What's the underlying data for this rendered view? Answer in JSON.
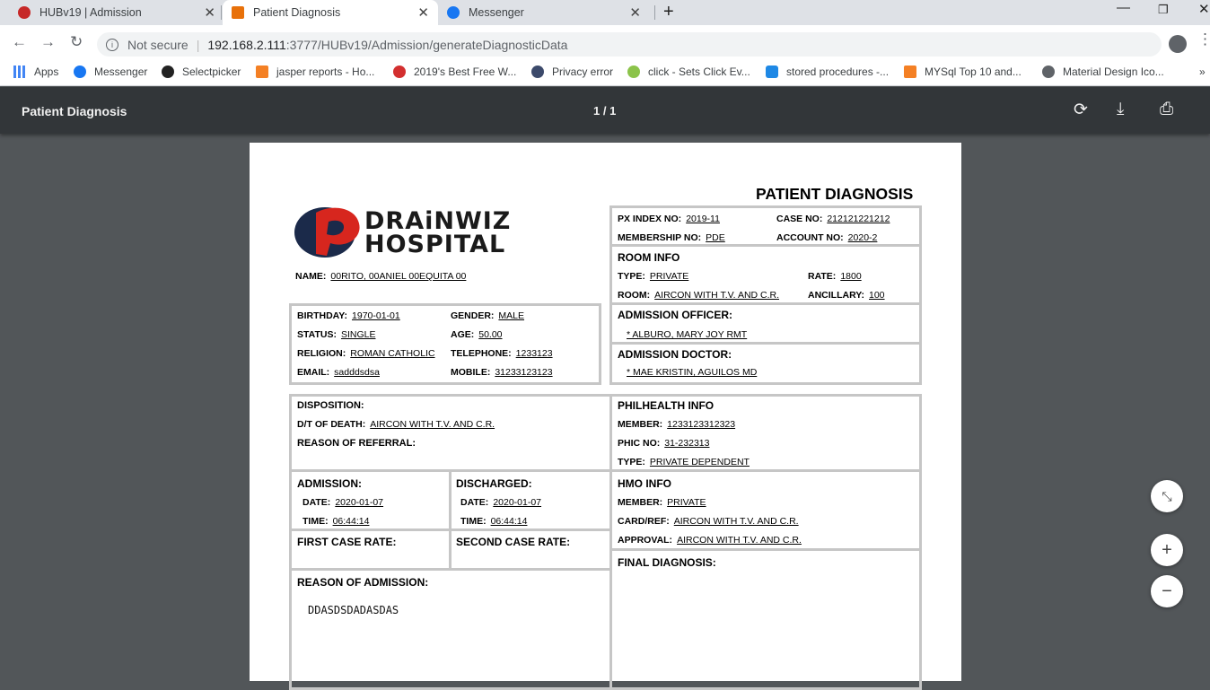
{
  "browser": {
    "tabs": [
      {
        "title": "HUBv19 | Admission",
        "active": false
      },
      {
        "title": "Patient Diagnosis",
        "active": true
      },
      {
        "title": "Messenger",
        "active": false
      }
    ],
    "security": "Not secure",
    "url_host": "192.168.2.111",
    "url_rest": ":3777/HUBv19/Admission/generateDiagnosticData",
    "bookmarks": [
      "Apps",
      "Messenger",
      "Selectpicker",
      "jasper reports - Ho...",
      "2019's Best Free W...",
      "Privacy error",
      "click - Sets Click Ev...",
      "stored procedures -...",
      "MYSql Top 10 and...",
      "Material Design Ico..."
    ],
    "more_bookmarks": "»"
  },
  "viewer": {
    "title": "Patient Diagnosis",
    "page_indicator": "1 / 1"
  },
  "report": {
    "title": "PATIENT DIAGNOSIS",
    "logo_line1": "DRAiNWIZ",
    "logo_line2": "HOSPITAL",
    "name_label": "NAME:",
    "name": "00RITO, 00ANIEL 00EQUITA 00",
    "px_index_label": "PX INDEX NO:",
    "px_index": "2019-11",
    "case_no_label": "CASE NO:",
    "case_no": "212121221212",
    "membership_label": "MEMBERSHIP NO:",
    "membership": "PDE",
    "account_label": "ACCOUNT NO:",
    "account": "2020-2",
    "room_info": "ROOM INFO",
    "type_label": "TYPE:",
    "room_type": "PRIVATE",
    "rate_label": "RATE:",
    "rate": "1800",
    "room_label": "ROOM:",
    "room": "AIRCON WITH T.V. AND C.R.",
    "ancillary_label": "ANCILLARY:",
    "ancillary": "100",
    "birthday_label": "BIRTHDAY:",
    "birthday": "1970-01-01",
    "gender_label": "GENDER:",
    "gender": "MALE",
    "status_label": "STATUS:",
    "status": "SINGLE",
    "age_label": "AGE:",
    "age": "50.00",
    "religion_label": "RELIGION:",
    "religion": "ROMAN CATHOLIC",
    "telephone_label": "TELEPHONE:",
    "telephone": "1233123",
    "email_label": "EMAIL:",
    "email": "sadddsdsa",
    "mobile_label": "MOBILE:",
    "mobile": "31233123123",
    "admission_officer_label": "ADMISSION OFFICER:",
    "admission_officer": "* ALBURO, MARY JOY RMT",
    "admission_doctor_label": "ADMISSION DOCTOR:",
    "admission_doctor": "* MAE KRISTIN, AGUILOS MD",
    "disposition_label": "DISPOSITION:",
    "dt_death_label": "D/T OF DEATH:",
    "dt_death": "AIRCON WITH T.V. AND C.R.",
    "referral_label": "REASON OF REFERRAL:",
    "philhealth_label": "PHILHEALTH INFO",
    "ph_member_label": "MEMBER:",
    "ph_member": "1233123312323",
    "phic_label": "PHIC NO:",
    "phic": "31-232313",
    "ph_type_label": "TYPE:",
    "ph_type": "PRIVATE DEPENDENT",
    "admission_label": "ADMISSION:",
    "adm_date_label": "DATE:",
    "adm_date": "2020-01-07",
    "adm_time_label": "TIME:",
    "adm_time": "06:44:14",
    "discharged_label": "DISCHARGED:",
    "dis_date_label": "DATE:",
    "dis_date": "2020-01-07",
    "dis_time_label": "TIME:",
    "dis_time": "06:44:14",
    "hmo_label": "HMO INFO",
    "hmo_member_label": "MEMBER:",
    "hmo_member": "PRIVATE",
    "card_label": "CARD/REF:",
    "card": "AIRCON WITH T.V. AND C.R.",
    "approval_label": "APPROVAL:",
    "approval": "AIRCON WITH T.V. AND C.R.",
    "first_case_label": "FIRST CASE RATE:",
    "second_case_label": "SECOND CASE RATE:",
    "final_dx_label": "FINAL DIAGNOSIS:",
    "reason_adm_label": "REASON OF ADMISSION:",
    "reason_adm": "DDASDSDADASDAS"
  }
}
